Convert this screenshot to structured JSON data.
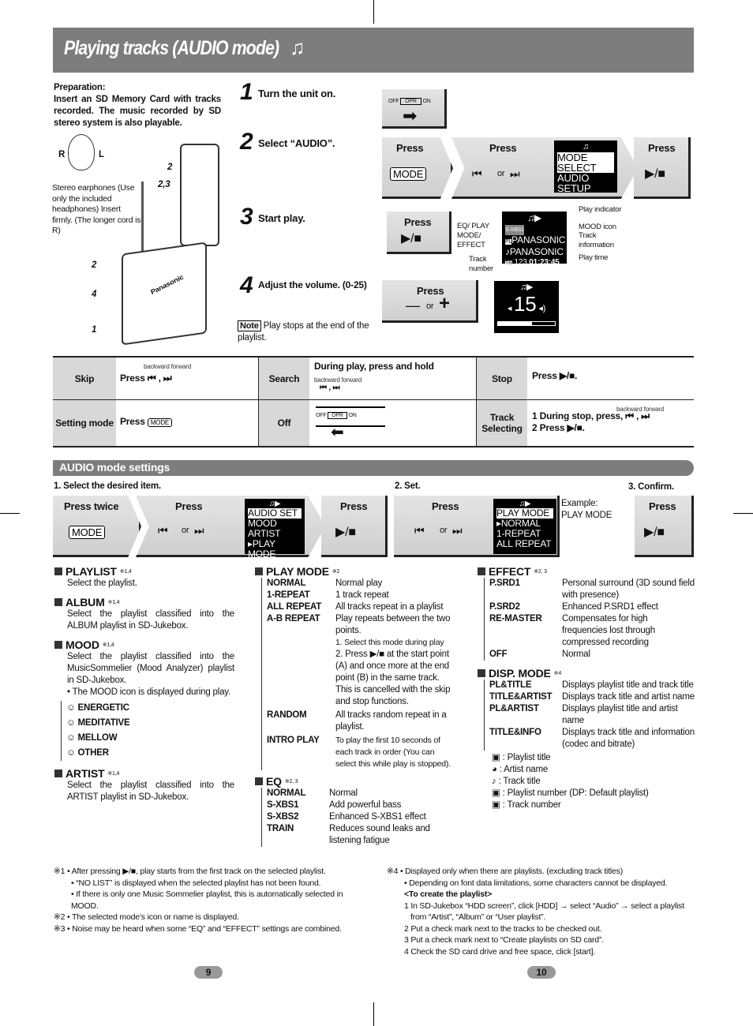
{
  "title": "Playing tracks (AUDIO mode)",
  "title_icon": "music-note-icon",
  "preparation": {
    "heading": "Preparation:",
    "text": "Insert an SD Memory Card with tracks recorded. The music recorded by SD stereo system is also playable."
  },
  "illustration": {
    "r": "R",
    "l": "L",
    "label_2": "2",
    "label_23": "2,3",
    "label_2b": "2",
    "label_4": "4",
    "label_1": "1",
    "brand": "Panasonic",
    "earphone_note": "Stereo earphones (Use only the included headphones) Insert firmly. (The longer cord is R)"
  },
  "steps": [
    {
      "num": "1",
      "text": "Turn the unit on."
    },
    {
      "num": "2",
      "text": "Select “AUDIO”."
    },
    {
      "num": "3",
      "text": "Start play."
    },
    {
      "num": "4",
      "text": "Adjust the volume. (0-25)"
    }
  ],
  "switch": {
    "off": "OFF",
    "opr": "OPR",
    "on": "ON"
  },
  "press": "Press",
  "or": "or",
  "mode_key": "MODE",
  "mode_select_lcd": [
    "MODE SELECT",
    "AUDIO",
    "SETUP"
  ],
  "play_lcd": {
    "eq": "S-XBS1",
    "line1": "PANASONIC",
    "line2": "PANASONIC",
    "track": "123",
    "time": "01:23:45",
    "tr": "TR",
    "pl": "PL"
  },
  "play_callouts": {
    "play_indicator": "Play indicator",
    "eq": "EQ/ PLAY MODE/ EFFECT",
    "mood": "MOOD icon",
    "track_info": "Track information",
    "play_time": "Play time",
    "track_number": "Track number"
  },
  "volume_lcd": "15",
  "volume_level_fraction": 0.6,
  "note": {
    "label": "Note",
    "text": "Play stops at the end of the playlist."
  },
  "table": {
    "skip": {
      "label": "Skip",
      "text": "Press",
      "dir": "backward  forward"
    },
    "search": {
      "label": "Search",
      "text": "During play, press and hold",
      "dir": "backward  forward"
    },
    "stop": {
      "label": "Stop",
      "text": "Press"
    },
    "setting": {
      "label": "Setting mode",
      "text": "Press"
    },
    "off": {
      "label": "Off"
    },
    "track": {
      "label": "Track Selecting",
      "line1": "1 During stop, press,",
      "line2": "2 Press",
      "dir": "backward  forward"
    }
  },
  "settings": {
    "bar": "AUDIO mode settings",
    "step1": "1. Select the desired item.",
    "step2": "2. Set.",
    "step3": "3. Confirm.",
    "press_twice": "Press twice",
    "lcd1": [
      "AUDIO SET",
      "MOOD",
      "ARTIST",
      "PLAY MODE"
    ],
    "lcd2": [
      "PLAY MODE",
      "NORMAL",
      "1-REPEAT",
      "ALL REPEAT"
    ],
    "example": "Example:",
    "example_value": "PLAY MODE"
  },
  "col1": {
    "playlist": {
      "h": "PLAYLIST",
      "n": "※1,4",
      "d": "Select the playlist."
    },
    "album": {
      "h": "ALBUM",
      "n": "※1,4",
      "d": "Select the playlist classified into the ALBUM playlist in SD-Jukebox."
    },
    "mood": {
      "h": "MOOD",
      "n": "※1,4",
      "d": "Select the playlist classified into the MusicSommelier (Mood Analyzer) playlist in SD-Jukebox.",
      "bullet": "• The MOOD icon is displayed during play.",
      "items": [
        "ENERGETIC",
        "MEDITATIVE",
        "MELLOW",
        "OTHER"
      ]
    },
    "artist": {
      "h": "ARTIST",
      "n": "※1,4",
      "d": "Select the playlist classified into the ARTIST playlist in SD-Jukebox."
    }
  },
  "col2": {
    "playmode": {
      "h": "PLAY MODE",
      "n": "※2",
      "rows": [
        {
          "k": "NORMAL",
          "v": "Normal play"
        },
        {
          "k": "1-REPEAT",
          "v": "1 track repeat"
        },
        {
          "k": "ALL REPEAT",
          "v": "All tracks repeat in a playlist"
        },
        {
          "k": "A-B REPEAT",
          "v": "Play repeats between the two points."
        }
      ],
      "ab1": "1. Select this mode during play",
      "ab2": "2. Press ▶/■ at the start point (A) and once more at the end point (B) in the same track.",
      "ab3": "This is cancelled with the skip and stop functions.",
      "random": {
        "k": "RANDOM",
        "v": "All tracks random repeat in a playlist."
      },
      "intro": {
        "k": "INTRO PLAY",
        "v": "To play the first 10 seconds of each track in order (You can select this while play is stopped)."
      }
    },
    "eq": {
      "h": "EQ",
      "n": "※2, 3",
      "rows": [
        {
          "k": "NORMAL",
          "v": "Normal"
        },
        {
          "k": "S-XBS1",
          "v": "Add powerful bass"
        },
        {
          "k": "S-XBS2",
          "v": "Enhanced S-XBS1 effect"
        },
        {
          "k": "TRAIN",
          "v": "Reduces sound leaks and listening fatigue"
        }
      ]
    }
  },
  "col3": {
    "effect": {
      "h": "EFFECT",
      "n": "※2, 3",
      "rows": [
        {
          "k": "P.SRD1",
          "v": "Personal surround (3D sound field with presence)"
        },
        {
          "k": "P.SRD2",
          "v": "Enhanced P.SRD1 effect"
        },
        {
          "k": "RE-MASTER",
          "v": "Compensates for high frequencies lost through compressed recording"
        },
        {
          "k": "OFF",
          "v": "Normal"
        }
      ]
    },
    "disp": {
      "h": "DISP. MODE",
      "n": "※4",
      "rows": [
        {
          "k": "PL&TITLE",
          "v": "Displays playlist title and track title"
        },
        {
          "k": "TITLE&ARTIST",
          "v": "Displays track title and artist name"
        },
        {
          "k": "PL&ARTIST",
          "v": "Displays playlist title and artist name"
        },
        {
          "k": "TITLE&INFO",
          "v": "Displays track title and information (codec and bitrate)"
        }
      ]
    },
    "legend": [
      ": Playlist title",
      ": Artist name",
      ": Track title",
      ": Playlist number (DP: Default playlist)",
      ": Track number"
    ]
  },
  "footnotes_left": [
    "※1 • After pressing ▶/■, play starts from the first track on the selected playlist.",
    "• “NO LIST” is displayed when the selected playlist has not been found.",
    "• If there is only one Music Sommelier playlist, this is automatically selected in MOOD.",
    "※2 • The selected mode’s icon or name is displayed.",
    "※3 • Noise may be heard when some “EQ” and “EFFECT” settings are combined."
  ],
  "footnotes_right": {
    "l1": "※4 • Displayed only when there are playlists. (excluding track titles)",
    "l2": "• Depending on font data limitations, some characters cannot be displayed.",
    "h": "<To create the playlist>",
    "steps": [
      "1 In SD-Jukebox “HDD screen”, click [HDD] → select “Audio” → select a playlist from “Artist”, “Album” or “User playlist”.",
      "2 Put a check mark next to the tracks to be checked out.",
      "3 Put a check mark next to “Create playlists on SD card”.",
      "4 Check the SD card drive and free space, click [start]."
    ]
  },
  "pages": [
    "9",
    "10"
  ]
}
